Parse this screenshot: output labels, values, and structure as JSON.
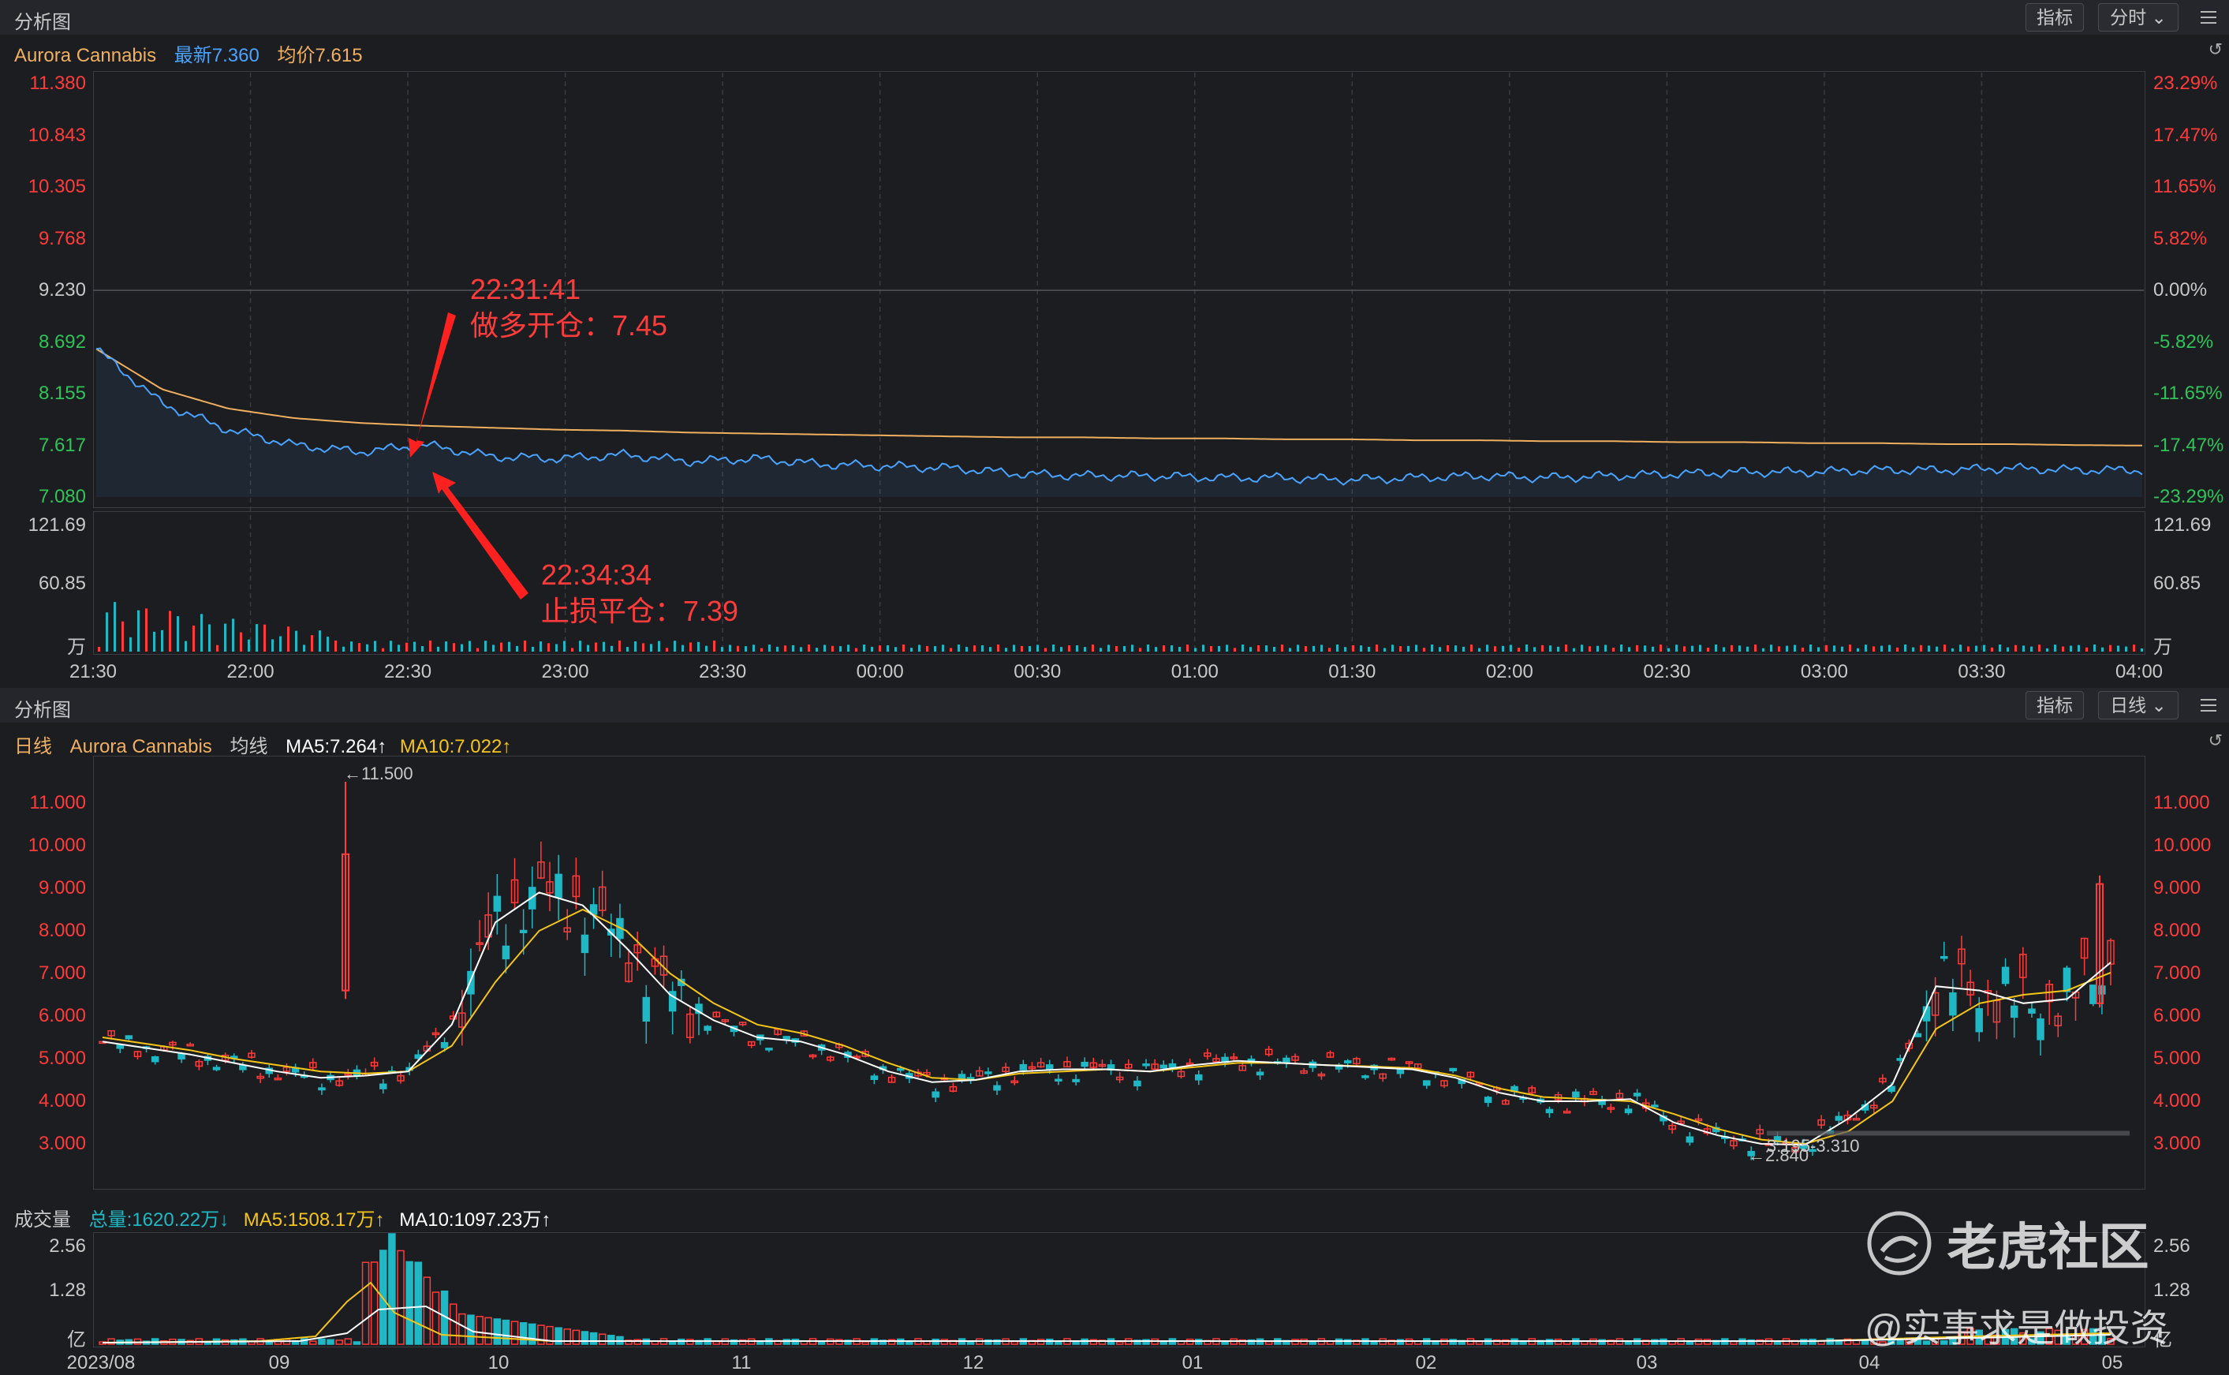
{
  "top_panel": {
    "header": {
      "title": "分析图",
      "indicator_btn": "指标",
      "period_btn": "分时 ⌄"
    },
    "info": {
      "name": "Aurora Cannabis",
      "latest": "最新7.360",
      "avg": "均价7.615"
    },
    "price_ticks_left": [
      "11.380",
      "10.843",
      "10.305",
      "9.768",
      "9.230",
      "8.692",
      "8.155",
      "7.617",
      "7.080"
    ],
    "pct_ticks_right": [
      "23.29%",
      "17.47%",
      "11.65%",
      "5.82%",
      "0.00%",
      "-5.82%",
      "-11.65%",
      "-17.47%",
      "-23.29%"
    ],
    "vol_ticks": [
      "121.69",
      "60.85",
      "万"
    ],
    "time_ticks": [
      "21:30",
      "22:00",
      "22:30",
      "23:00",
      "23:30",
      "00:00",
      "00:30",
      "01:00",
      "01:30",
      "02:00",
      "02:30",
      "03:00",
      "03:30",
      "04:00"
    ],
    "annotation_open": {
      "time": "22:31:41",
      "text": "做多开仓：7.45"
    },
    "annotation_close": {
      "time": "22:34:34",
      "text": "止损平仓：7.39"
    }
  },
  "daily_panel": {
    "header": {
      "title": "分析图",
      "indicator_btn": "指标",
      "period_btn": "日线 ⌄"
    },
    "info": {
      "period": "日线",
      "name": "Aurora Cannabis",
      "avg_label": "均线",
      "ma5": "MA5:7.264↑",
      "ma10": "MA10:7.022↑"
    },
    "price_ticks": [
      "11.000",
      "10.000",
      "9.000",
      "8.000",
      "7.000",
      "6.000",
      "5.000",
      "4.000",
      "3.000"
    ],
    "high_label": "←11.500",
    "low_label": "←2.840",
    "range_label": "3.195-3.310"
  },
  "volume_panel": {
    "info": {
      "title": "成交量",
      "total": "总量:1620.22万↓",
      "ma5": "MA5:1508.17万↑",
      "ma10": "MA10:1097.23万↑"
    },
    "ticks": [
      "2.56",
      "1.28",
      "亿"
    ],
    "date_ticks": [
      "2023/08",
      "09",
      "10",
      "11",
      "12",
      "01",
      "02",
      "03",
      "04",
      "05"
    ]
  },
  "watermark": {
    "brand": "老虎社区",
    "author": "@实事求是做投资"
  },
  "colors": {
    "up": "#ff3b3b",
    "down": "#1fb8c4",
    "ma5": "#ffffff",
    "ma10": "#f5c518",
    "intraday": "#4aa3ff",
    "avg": "#f0b060",
    "green": "#2fc35a"
  },
  "chart_data": [
    {
      "type": "line",
      "series": [
        {
          "name": "最新",
          "values": [
            8.62,
            8.05,
            7.78,
            7.62,
            7.55,
            7.62,
            7.5,
            7.48,
            7.52,
            7.45,
            7.48,
            7.42,
            7.4,
            7.38,
            7.32,
            7.3,
            7.3,
            7.28,
            7.28,
            7.26,
            7.28,
            7.3,
            7.28,
            7.3,
            7.32,
            7.34,
            7.34,
            7.36,
            7.36,
            7.38,
            7.36,
            7.36
          ]
        },
        {
          "name": "均价",
          "values": [
            8.62,
            8.2,
            8.0,
            7.9,
            7.85,
            7.82,
            7.8,
            7.78,
            7.77,
            7.75,
            7.74,
            7.73,
            7.72,
            7.71,
            7.7,
            7.7,
            7.69,
            7.69,
            7.68,
            7.68,
            7.67,
            7.67,
            7.66,
            7.66,
            7.65,
            7.65,
            7.64,
            7.64,
            7.63,
            7.63,
            7.62,
            7.615
          ]
        }
      ],
      "ylim": [
        7.08,
        11.38
      ]
    },
    {
      "type": "candlestick",
      "series": [
        {
          "name": "MA5",
          "values": [
            5.4,
            5.25,
            5.1,
            4.9,
            4.7,
            4.55,
            4.6,
            4.7,
            5.8,
            8.2,
            8.9,
            8.6,
            7.6,
            6.5,
            5.9,
            5.5,
            5.4,
            5.1,
            4.7,
            4.45,
            4.5,
            4.7,
            4.75,
            4.75,
            4.7,
            4.85,
            4.95,
            4.9,
            4.85,
            4.8,
            4.75,
            4.55,
            4.2,
            4.0,
            4.0,
            4.05,
            3.5,
            3.2,
            3.0,
            2.98,
            3.6,
            4.4,
            6.7,
            6.6,
            6.3,
            6.4,
            7.26
          ]
        },
        {
          "name": "MA10",
          "values": [
            5.5,
            5.35,
            5.2,
            5.0,
            4.85,
            4.7,
            4.65,
            4.7,
            5.3,
            6.8,
            8.0,
            8.5,
            8.0,
            7.0,
            6.3,
            5.8,
            5.6,
            5.3,
            4.9,
            4.55,
            4.5,
            4.65,
            4.7,
            4.75,
            4.7,
            4.8,
            4.9,
            4.9,
            4.85,
            4.82,
            4.78,
            4.6,
            4.3,
            4.1,
            4.05,
            4.0,
            3.7,
            3.35,
            3.1,
            3.0,
            3.3,
            4.0,
            5.7,
            6.3,
            6.5,
            6.6,
            7.02
          ]
        }
      ],
      "ylim": [
        2.0,
        12.0
      ]
    },
    {
      "type": "bar",
      "ylim": [
        0,
        2.56
      ]
    }
  ]
}
